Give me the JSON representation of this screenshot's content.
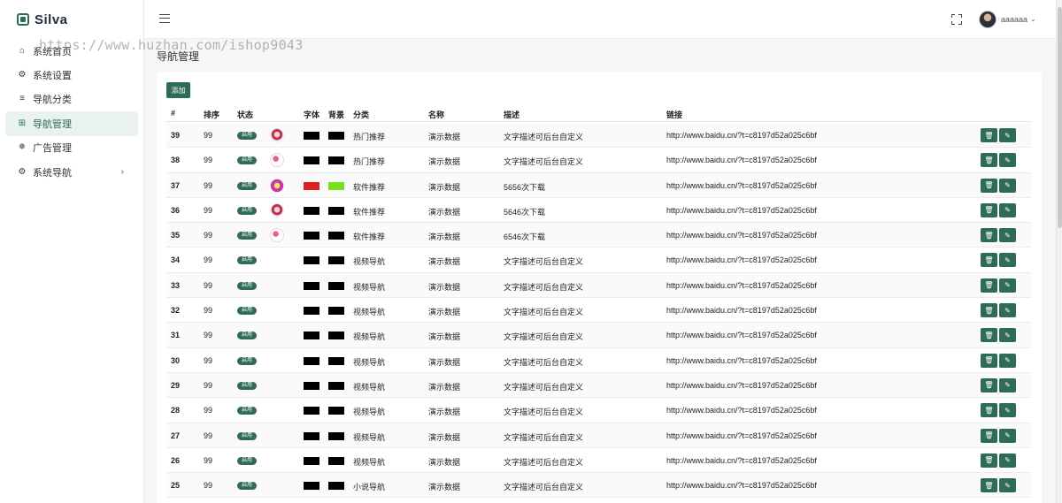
{
  "app": {
    "name": "Silva"
  },
  "watermark": "https://www.huzhan.com/ishop9043",
  "sidebar": {
    "items": [
      {
        "label": "系统首页",
        "icon": "home-icon",
        "active": false,
        "has_children": false
      },
      {
        "label": "系统设置",
        "icon": "gear-icon",
        "active": false,
        "has_children": false
      },
      {
        "label": "导航分类",
        "icon": "list-icon",
        "active": false,
        "has_children": false
      },
      {
        "label": "导航管理",
        "icon": "grid-icon",
        "active": true,
        "has_children": false
      },
      {
        "label": "广告管理",
        "icon": "spinner-icon",
        "active": false,
        "has_children": false
      },
      {
        "label": "系统导航",
        "icon": "gear-icon",
        "active": false,
        "has_children": true
      }
    ]
  },
  "header": {
    "username": "aaaaaa"
  },
  "page": {
    "title": "导航管理",
    "add_label": "添加"
  },
  "table": {
    "columns": [
      "#",
      "排序",
      "状态",
      "字体",
      "背景",
      "分类",
      "名称",
      "描述",
      "链接"
    ],
    "rows": [
      {
        "id": "39",
        "sort": "99",
        "status": "启用",
        "thumb": "a",
        "font_color": "#000000",
        "bg_color": "#000000",
        "category": "热门推荐",
        "name": "演示数据",
        "desc": "文字描述可后台自定义",
        "link": "http://www.baidu.cn/?t=c8197d52a025c6bf"
      },
      {
        "id": "38",
        "sort": "99",
        "status": "启用",
        "thumb": "b",
        "font_color": "#000000",
        "bg_color": "#000000",
        "category": "热门推荐",
        "name": "演示数据",
        "desc": "文字描述可后台自定义",
        "link": "http://www.baidu.cn/?t=c8197d52a025c6bf"
      },
      {
        "id": "37",
        "sort": "99",
        "status": "启用",
        "thumb": "c",
        "font_color": "#e02020",
        "bg_color": "#77e21a",
        "category": "软件推荐",
        "name": "演示数据",
        "desc": "5656次下载",
        "link": "http://www.baidu.cn/?t=c8197d52a025c6bf"
      },
      {
        "id": "36",
        "sort": "99",
        "status": "启用",
        "thumb": "a",
        "font_color": "#000000",
        "bg_color": "#000000",
        "category": "软件推荐",
        "name": "演示数据",
        "desc": "5646次下载",
        "link": "http://www.baidu.cn/?t=c8197d52a025c6bf"
      },
      {
        "id": "35",
        "sort": "99",
        "status": "启用",
        "thumb": "b",
        "font_color": "#000000",
        "bg_color": "#000000",
        "category": "软件推荐",
        "name": "演示数据",
        "desc": "6546次下载",
        "link": "http://www.baidu.cn/?t=c8197d52a025c6bf"
      },
      {
        "id": "34",
        "sort": "99",
        "status": "启用",
        "thumb": "",
        "font_color": "#000000",
        "bg_color": "#000000",
        "category": "视频导航",
        "name": "演示数据",
        "desc": "文字描述可后台自定义",
        "link": "http://www.baidu.cn/?t=c8197d52a025c6bf"
      },
      {
        "id": "33",
        "sort": "99",
        "status": "启用",
        "thumb": "",
        "font_color": "#000000",
        "bg_color": "#000000",
        "category": "视频导航",
        "name": "演示数据",
        "desc": "文字描述可后台自定义",
        "link": "http://www.baidu.cn/?t=c8197d52a025c6bf"
      },
      {
        "id": "32",
        "sort": "99",
        "status": "启用",
        "thumb": "",
        "font_color": "#000000",
        "bg_color": "#000000",
        "category": "视频导航",
        "name": "演示数据",
        "desc": "文字描述可后台自定义",
        "link": "http://www.baidu.cn/?t=c8197d52a025c6bf"
      },
      {
        "id": "31",
        "sort": "99",
        "status": "启用",
        "thumb": "",
        "font_color": "#000000",
        "bg_color": "#000000",
        "category": "视频导航",
        "name": "演示数据",
        "desc": "文字描述可后台自定义",
        "link": "http://www.baidu.cn/?t=c8197d52a025c6bf"
      },
      {
        "id": "30",
        "sort": "99",
        "status": "启用",
        "thumb": "",
        "font_color": "#000000",
        "bg_color": "#000000",
        "category": "视频导航",
        "name": "演示数据",
        "desc": "文字描述可后台自定义",
        "link": "http://www.baidu.cn/?t=c8197d52a025c6bf"
      },
      {
        "id": "29",
        "sort": "99",
        "status": "启用",
        "thumb": "",
        "font_color": "#000000",
        "bg_color": "#000000",
        "category": "视频导航",
        "name": "演示数据",
        "desc": "文字描述可后台自定义",
        "link": "http://www.baidu.cn/?t=c8197d52a025c6bf"
      },
      {
        "id": "28",
        "sort": "99",
        "status": "启用",
        "thumb": "",
        "font_color": "#000000",
        "bg_color": "#000000",
        "category": "视频导航",
        "name": "演示数据",
        "desc": "文字描述可后台自定义",
        "link": "http://www.baidu.cn/?t=c8197d52a025c6bf"
      },
      {
        "id": "27",
        "sort": "99",
        "status": "启用",
        "thumb": "",
        "font_color": "#000000",
        "bg_color": "#000000",
        "category": "视频导航",
        "name": "演示数据",
        "desc": "文字描述可后台自定义",
        "link": "http://www.baidu.cn/?t=c8197d52a025c6bf"
      },
      {
        "id": "26",
        "sort": "99",
        "status": "启用",
        "thumb": "",
        "font_color": "#000000",
        "bg_color": "#000000",
        "category": "视频导航",
        "name": "演示数据",
        "desc": "文字描述可后台自定义",
        "link": "http://www.baidu.cn/?t=c8197d52a025c6bf"
      },
      {
        "id": "25",
        "sort": "99",
        "status": "启用",
        "thumb": "",
        "font_color": "#000000",
        "bg_color": "#000000",
        "category": "小说导航",
        "name": "演示数据",
        "desc": "文字描述可后台自定义",
        "link": "http://www.baidu.cn/?t=c8197d52a025c6bf"
      }
    ]
  },
  "colors": {
    "accent": "#2f6b59",
    "active_bg": "#e9f2ef"
  }
}
